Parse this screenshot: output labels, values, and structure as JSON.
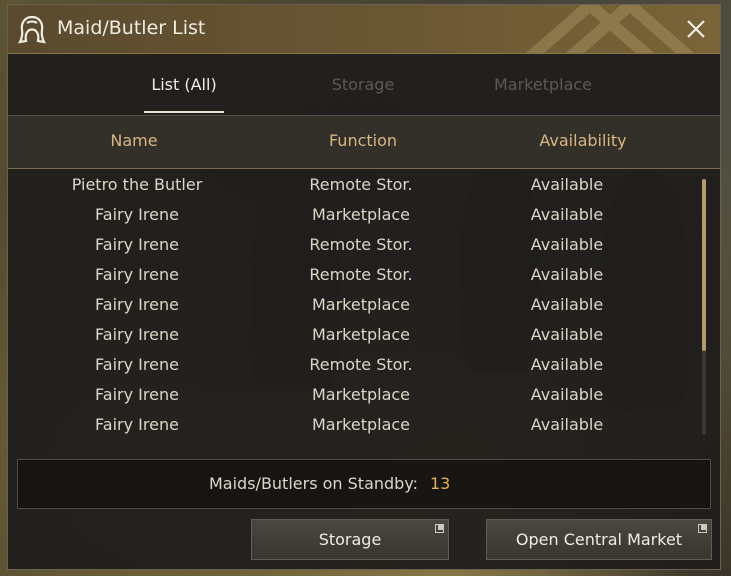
{
  "window": {
    "title": "Maid/Butler List"
  },
  "tabs": [
    {
      "label": "List (All)",
      "active": true
    },
    {
      "label": "Storage",
      "active": false
    },
    {
      "label": "Marketplace",
      "active": false
    }
  ],
  "table": {
    "columns": [
      "Name",
      "Function",
      "Availability"
    ],
    "rows": [
      {
        "name": "Pietro the Butler",
        "function": "Remote Stor.",
        "availability": "Available"
      },
      {
        "name": "Fairy Irene",
        "function": "Marketplace",
        "availability": "Available"
      },
      {
        "name": "Fairy Irene",
        "function": "Remote Stor.",
        "availability": "Available"
      },
      {
        "name": "Fairy Irene",
        "function": "Remote Stor.",
        "availability": "Available"
      },
      {
        "name": "Fairy Irene",
        "function": "Marketplace",
        "availability": "Available"
      },
      {
        "name": "Fairy Irene",
        "function": "Marketplace",
        "availability": "Available"
      },
      {
        "name": "Fairy Irene",
        "function": "Remote Stor.",
        "availability": "Available"
      },
      {
        "name": "Fairy Irene",
        "function": "Marketplace",
        "availability": "Available"
      },
      {
        "name": "Fairy Irene",
        "function": "Marketplace",
        "availability": "Available"
      }
    ]
  },
  "scroll": {
    "visible_fraction": 0.67,
    "position": 0
  },
  "standby": {
    "label": "Maids/Butlers on Standby:",
    "value": "13"
  },
  "buttons": {
    "storage": "Storage",
    "open_market": "Open Central Market"
  },
  "icons": {
    "title": "maid-head-icon",
    "close": "close-icon",
    "button_corner": "external-window-icon"
  },
  "colors": {
    "accent_gold": "#d9b682",
    "value_gold": "#e5b24b",
    "title_bar": "#6a5733"
  }
}
